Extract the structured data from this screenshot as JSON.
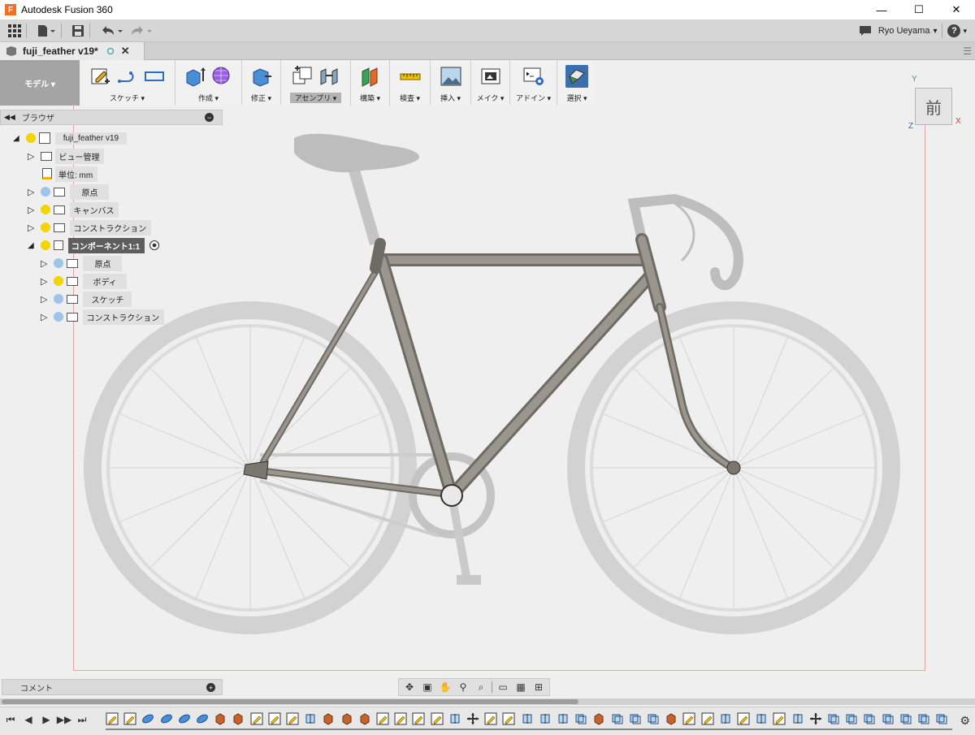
{
  "app": {
    "title": "Autodesk Fusion 360",
    "logo": "F"
  },
  "window_controls": {
    "minimize": "—",
    "maximize": "☐",
    "close": "✕"
  },
  "user": {
    "name": "Ryo Ueyama",
    "dropdown": "▾",
    "help": "?"
  },
  "document_tab": {
    "title": "fuji_feather v19*"
  },
  "ribbon": {
    "workspace": "モデル ▾",
    "groups": [
      {
        "label": "スケッチ ▾"
      },
      {
        "label": "作成 ▾"
      },
      {
        "label": "修正 ▾"
      },
      {
        "label": "アセンブリ ▾"
      },
      {
        "label": "構築 ▾"
      },
      {
        "label": "検査 ▾"
      },
      {
        "label": "挿入 ▾"
      },
      {
        "label": "メイク ▾"
      },
      {
        "label": "アドイン ▾"
      },
      {
        "label": "選択 ▾"
      }
    ]
  },
  "browser": {
    "title": "ブラウザ",
    "items": [
      {
        "label": "fuji_feather v19"
      },
      {
        "label": "ビュー管理"
      },
      {
        "label": "単位: mm"
      },
      {
        "label": "原点"
      },
      {
        "label": "キャンバス"
      },
      {
        "label": "コンストラクション"
      },
      {
        "label": "コンポーネント1:1"
      },
      {
        "label": "原点"
      },
      {
        "label": "ボディ"
      },
      {
        "label": "スケッチ"
      },
      {
        "label": "コンストラクション"
      }
    ]
  },
  "viewcube": {
    "face_label": "前",
    "axis_x": "X",
    "axis_y": "Y",
    "axis_z": "Z"
  },
  "comment": {
    "label": "コメント"
  },
  "colors": {
    "accent": "#3a6fb0",
    "frame": "#8a857e",
    "wheel": "#cfcfcf",
    "canvas_border": "#e6a6a6"
  }
}
